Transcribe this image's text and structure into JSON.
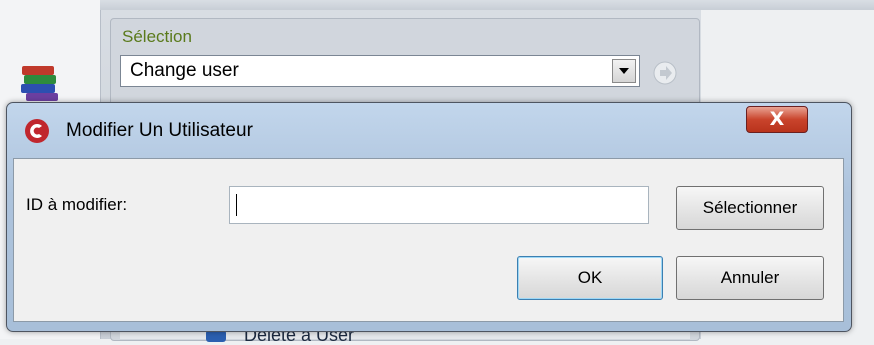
{
  "background": {
    "selection_label": "Sélection",
    "selection_value": "Change user",
    "bottom_item_label": "Delete a User"
  },
  "dialog": {
    "title": "Modifier Un Utilisateur",
    "close_label": "X",
    "id_label": "ID à modifier:",
    "id_value": "",
    "select_button": "Sélectionner",
    "ok_button": "OK",
    "cancel_button": "Annuler"
  },
  "icons": {
    "app_icon": "books-icon",
    "go_icon": "arrow-right-icon",
    "dialog_icon": "app-logo-icon",
    "close_icon": "close-icon"
  },
  "colors": {
    "title_bar": "#adc3dc",
    "close_button": "#c9442c",
    "selection_label": "#5a7a1b",
    "client_bg": "#f0f0f0"
  }
}
